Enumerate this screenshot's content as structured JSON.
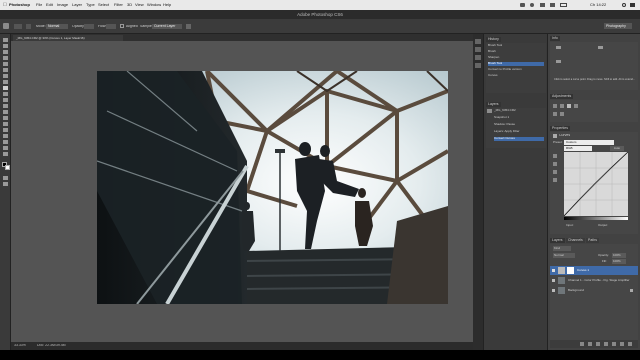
{
  "menubar": {
    "app": "Photoshop",
    "items": [
      "File",
      "Edit",
      "Image",
      "Layer",
      "Type",
      "Select",
      "Filter",
      "3D",
      "View",
      "Window",
      "Help"
    ],
    "clock": "Ch 14:22"
  },
  "window": {
    "title": "Adobe Photoshop CS6",
    "workspace": "Photography"
  },
  "options": {
    "mode_value": "Normal",
    "opacity_label": "Opacity:",
    "flow_label": "Flow:",
    "align_label": "Aligned",
    "sample_label": "Sample:",
    "sample_value": "Current Layer"
  },
  "document": {
    "tab_label": "_MG_9454.CR2 @ 33% (Curves 1, Layer Mask/16)",
    "zoom": "33.33%",
    "doc_info": "Doc: 22.3M/39.4M"
  },
  "history": {
    "tab": "History",
    "items": [
      "Brush Tool",
      "Brush",
      "Sharpen",
      "Brush Tool",
      "Convert to Profile version",
      "Curves"
    ]
  },
  "layers_mini": {
    "tab": "Layers",
    "items": [
      "_MG_9454.CR2",
      "Snapshot 1",
      "Shadow: Pause",
      "Layers: Apply Filter",
      "Convert Curves"
    ]
  },
  "properties": {
    "tab": "Properties",
    "section": "Curves",
    "preset_label": "Preset:",
    "preset_value": "Custom",
    "channel_value": "RGB",
    "auto_label": "Auto",
    "input_label": "Input:",
    "output_label": "Output:"
  },
  "info": {
    "tab": "Info",
    "hint": "Click to select a curve point. Drag to move. Shift to add. Alt to extend..."
  },
  "adjustments": {
    "tab": "Adjustments"
  },
  "layers": {
    "tabs": [
      "Layers",
      "Channels",
      "Paths"
    ],
    "kind_label": "Kind",
    "mode_value": "Normal",
    "opacity_label": "Opacity:",
    "opacity_value": "100%",
    "fill_label": "Fill:",
    "fill_value": "100%",
    "items": [
      "Curves 1",
      "Channel 1 - Color Profile - Fig. Stage Amplifier",
      "Background"
    ]
  },
  "colors": {
    "menubar_bg": "#e9e9e9",
    "chrome": "#3a3a3a",
    "canvas_bg": "#545454",
    "selection": "#3f6aa8"
  }
}
